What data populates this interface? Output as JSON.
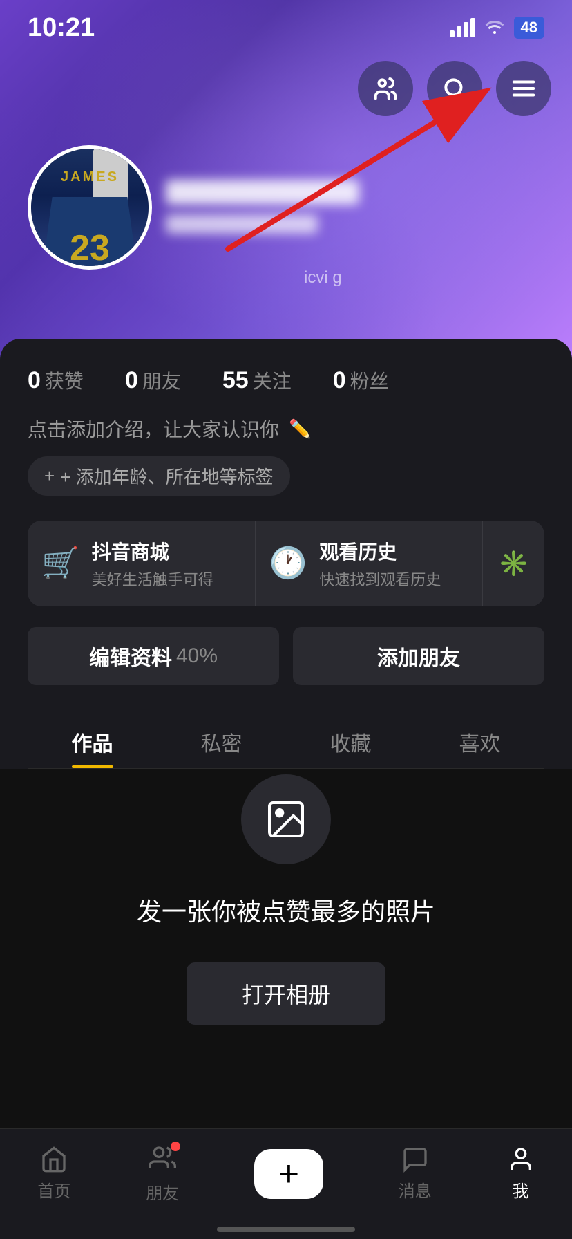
{
  "statusBar": {
    "time": "10:21",
    "battery": "48"
  },
  "topActions": {
    "friendsBtn": "friends-icon",
    "searchBtn": "search-icon",
    "menuBtn": "menu-icon"
  },
  "profile": {
    "avatarAlt": "James 23 jersey",
    "stats": [
      {
        "num": "0",
        "label": "获赞"
      },
      {
        "num": "0",
        "label": "朋友"
      },
      {
        "num": "55",
        "label": "关注"
      },
      {
        "num": "0",
        "label": "粉丝"
      }
    ],
    "bioPlaceholder": "点击添加介绍，让大家认识你",
    "tagsBtnLabel": "+ 添加年龄、所在地等标签"
  },
  "features": [
    {
      "title": "抖音商城",
      "subtitle": "美好生活触手可得"
    },
    {
      "title": "观看历史",
      "subtitle": "快速找到观看历史"
    }
  ],
  "actionButtons": {
    "edit": "编辑资料",
    "editPercent": "40%",
    "addFriend": "添加朋友"
  },
  "tabs": [
    {
      "label": "作品",
      "active": true
    },
    {
      "label": "私密",
      "active": false
    },
    {
      "label": "收藏",
      "active": false
    },
    {
      "label": "喜欢",
      "active": false
    }
  ],
  "emptyState": {
    "title": "发一张你被点赞最多的照片",
    "btnLabel": "打开相册"
  },
  "bottomNav": [
    {
      "label": "首页",
      "active": false
    },
    {
      "label": "朋友",
      "active": false,
      "hasDot": true
    },
    {
      "label": "",
      "isPlus": true
    },
    {
      "label": "消息",
      "active": false
    },
    {
      "label": "我",
      "active": true
    }
  ]
}
